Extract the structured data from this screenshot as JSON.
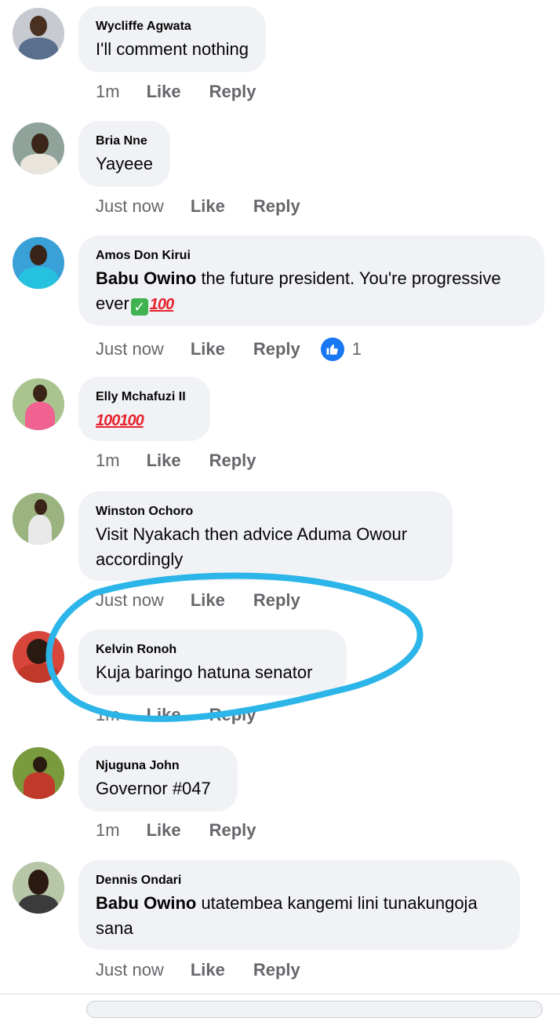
{
  "comments": [
    {
      "author": "Wycliffe Agwata",
      "mention": "",
      "text": "I'll comment nothing",
      "time": "1m",
      "like": "Like",
      "reply": "Reply",
      "reactions": ""
    },
    {
      "author": "Bria Nne",
      "mention": "",
      "text": "Yayeee",
      "time": "Just now",
      "like": "Like",
      "reply": "Reply",
      "reactions": ""
    },
    {
      "author": "Amos Don Kirui",
      "mention": "Babu Owino",
      "text": " the future president. You're progressive ever",
      "time": "Just now",
      "like": "Like",
      "reply": "Reply",
      "reactions": "1"
    },
    {
      "author": "Elly Mchafuzi II",
      "mention": "",
      "text": "",
      "time": "1m",
      "like": "Like",
      "reply": "Reply",
      "reactions": ""
    },
    {
      "author": "Winston Ochoro",
      "mention": "",
      "text": "Visit Nyakach then advice Aduma Owour accordingly",
      "time": "Just now",
      "like": "Like",
      "reply": "Reply",
      "reactions": ""
    },
    {
      "author": "Kelvin Ronoh",
      "mention": "",
      "text": "Kuja baringo hatuna senator",
      "time": "1m",
      "like": "Like",
      "reply": "Reply",
      "reactions": ""
    },
    {
      "author": "Njuguna John",
      "mention": "",
      "text": "Governor #047",
      "time": "1m",
      "like": "Like",
      "reply": "Reply",
      "reactions": ""
    },
    {
      "author": "Dennis Ondari",
      "mention": "Babu Owino",
      "text": " utatembea kangemi lini tunakungoja sana",
      "time": "Just now",
      "like": "Like",
      "reply": "Reply",
      "reactions": ""
    }
  ],
  "emoji": {
    "hundred": "100",
    "check": "✓"
  },
  "colors": {
    "bubble": "#f0f2f5",
    "meta": "#65676b",
    "like_blue": "#1877f2",
    "highlight": "#2bb5e8"
  },
  "icons": {
    "reaction": "thumbs-up-icon"
  }
}
